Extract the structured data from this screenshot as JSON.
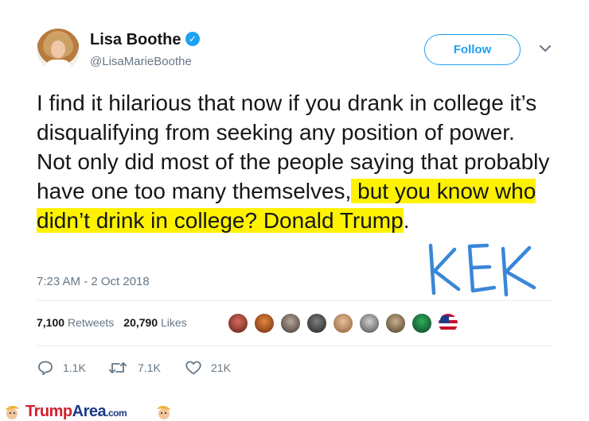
{
  "tweet": {
    "author_name": "Lisa Boothe",
    "handle": "@LisaMarieBoothe",
    "verified_mark": "✓",
    "follow_label": "Follow",
    "text_plain": "I find it hilarious that now if you drank in college it’s disqualifying from seeking any position of power. Not only did most of the people saying that probably have one too many themselves,",
    "text_highlighted": " but you know who didn’t drink in college? Donald Trump",
    "text_after": ".",
    "timestamp": "7:23 AM - 2 Oct 2018",
    "retweets_count": "7,100",
    "retweets_label": "Retweets",
    "likes_count": "20,790",
    "likes_label": "Likes",
    "reply_count": "1.1K",
    "retweet_action_count": "7.1K",
    "like_action_count": "21K"
  },
  "annotation": {
    "text": "KEK",
    "color": "#3a86d8"
  },
  "colors": {
    "highlight": "#fff200",
    "accent": "#1da1f2",
    "secondary_text": "#657786"
  },
  "footer": {
    "brand_red": "Trump",
    "brand_blue": "Area",
    "brand_suffix": ".com"
  }
}
